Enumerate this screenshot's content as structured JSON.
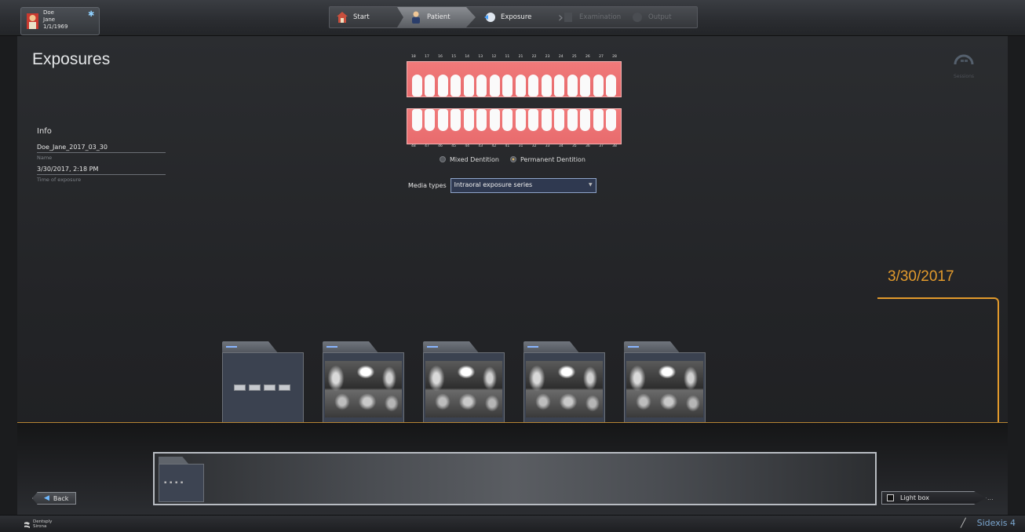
{
  "patient": {
    "last_name": "Doe",
    "first_name": "Jane",
    "dob": "1/1/1969",
    "pin_icon": "pin-icon"
  },
  "workflow": {
    "steps": [
      {
        "label": "Start",
        "icon": "house-icon",
        "state": "done"
      },
      {
        "label": "Patient",
        "icon": "patient-icon",
        "state": "active"
      },
      {
        "label": "Exposure",
        "icon": "exposure-icon",
        "state": "normal"
      },
      {
        "label": "Examination",
        "icon": "examination-icon",
        "state": "disabled"
      },
      {
        "label": "Output",
        "icon": "output-icon",
        "state": "disabled"
      }
    ]
  },
  "toolbar_icons": [
    "exit-door-icon",
    "tools-icon",
    "settings-gear-icon",
    "monitor-icon",
    "help-icon"
  ],
  "page": {
    "title": "Exposures"
  },
  "info": {
    "header": "Info",
    "name_value": "Doe_Jane_2017_03_30",
    "name_label": "Name",
    "time_value": "3/30/2017, 2:18 PM",
    "time_label": "Time of exposure"
  },
  "dental_chart": {
    "upper_numbers": [
      "18",
      "17",
      "16",
      "15",
      "14",
      "13",
      "12",
      "11",
      "21",
      "22",
      "23",
      "24",
      "25",
      "26",
      "27",
      "28"
    ],
    "lower_numbers": [
      "48",
      "47",
      "46",
      "45",
      "44",
      "43",
      "42",
      "41",
      "31",
      "32",
      "33",
      "34",
      "35",
      "36",
      "37",
      "38"
    ]
  },
  "dentition": {
    "mixed_label": "Mixed Dentition",
    "permanent_label": "Permanent Dentition",
    "selected": "permanent"
  },
  "media_types": {
    "label": "Media types",
    "selected": "Intraoral exposure series"
  },
  "sessions": {
    "label": "Sessions",
    "icon": "sessions-gauge-icon"
  },
  "timeline": {
    "date": "3/30/2017",
    "accent_color": "#e29a2c"
  },
  "exposure_folders": [
    {
      "kind": "series"
    },
    {
      "kind": "xray"
    },
    {
      "kind": "xray"
    },
    {
      "kind": "xray"
    },
    {
      "kind": "xray"
    }
  ],
  "buttons": {
    "back": "Back",
    "lightbox": "Light box",
    "lightbox_more": "..."
  },
  "statusbar": {
    "brand_line1": "Dentsply",
    "brand_line2": "Sirona",
    "product": "Sidexis 4"
  }
}
